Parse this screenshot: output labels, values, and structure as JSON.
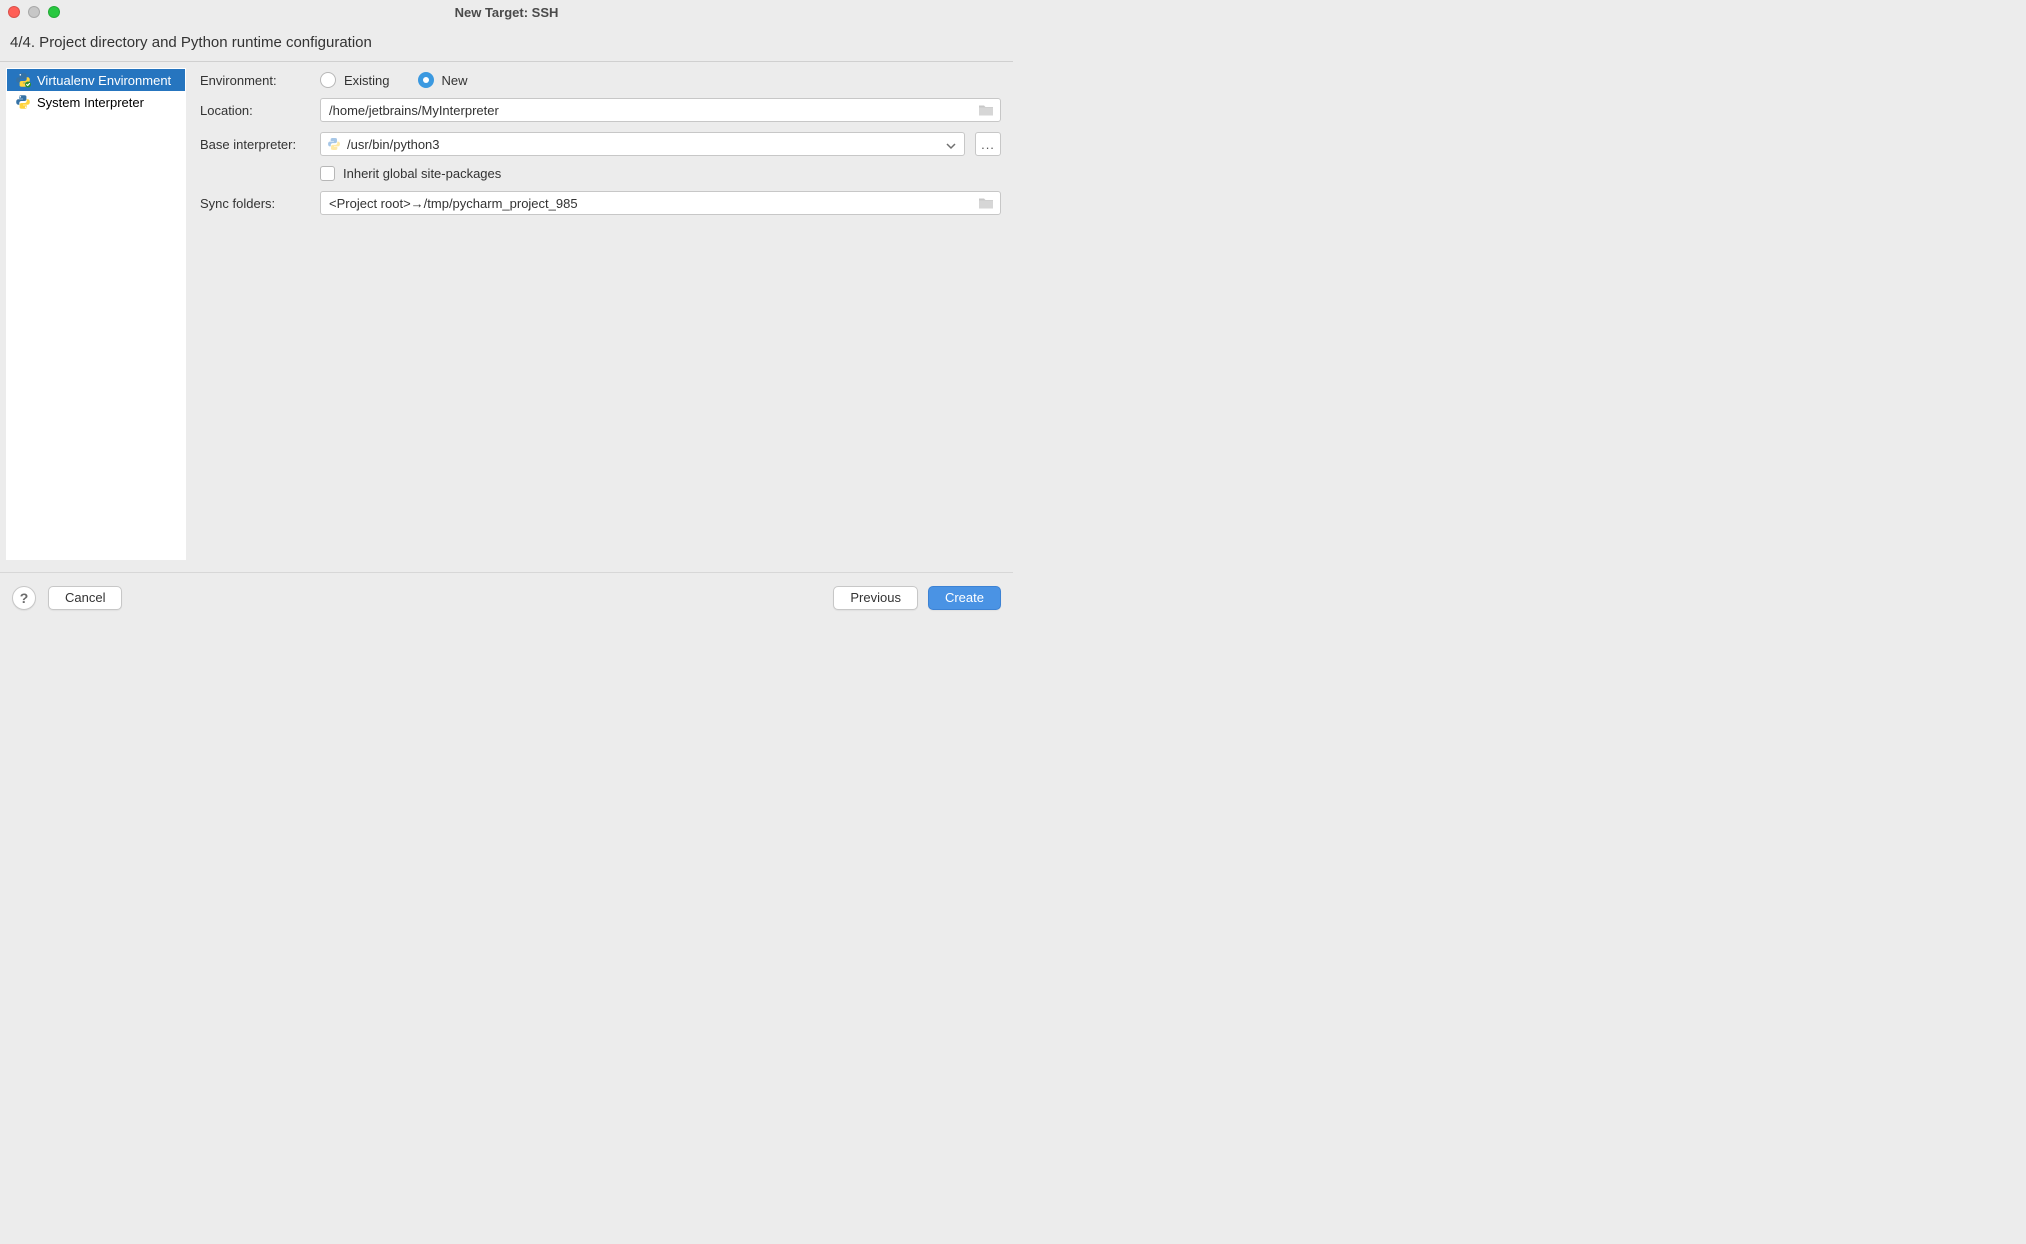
{
  "window": {
    "title": "New Target: SSH"
  },
  "step": {
    "header": "4/4. Project directory and Python runtime configuration"
  },
  "sidebar": {
    "items": [
      {
        "label": "Virtualenv Environment",
        "selected": true
      },
      {
        "label": "System Interpreter",
        "selected": false
      }
    ]
  },
  "form": {
    "environment_label": "Environment:",
    "radio_existing": "Existing",
    "radio_new": "New",
    "location_label": "Location:",
    "location_value": "/home/jetbrains/MyInterpreter",
    "base_interpreter_label": "Base interpreter:",
    "base_interpreter_value": "/usr/bin/python3",
    "inherit_label": "Inherit global site-packages",
    "sync_label": "Sync folders:",
    "sync_value": "<Project root>→/tmp/pycharm_project_985"
  },
  "footer": {
    "help": "?",
    "cancel": "Cancel",
    "previous": "Previous",
    "create": "Create"
  }
}
